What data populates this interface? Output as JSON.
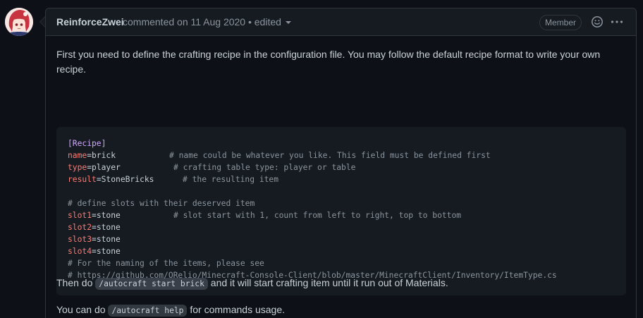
{
  "comment": {
    "author": "ReinforceZwei",
    "meta_text": "commented on 11 Aug 2020 • edited",
    "badge": "Member",
    "avatar_icon": "anime-girl-avatar",
    "emoji_icon": "smiley-icon",
    "more_icon": "kebab-horizontal-icon"
  },
  "body": {
    "intro": "First you need to define the crafting recipe in the configuration file. You may follow the default recipe format to write your own recipe.",
    "code": {
      "section": "[Recipe]",
      "name_key": "name",
      "name_val": "=brick",
      "name_comment": "# name could be whatever you like. This field must be defined first",
      "type_key": "type",
      "type_val": "=player",
      "type_comment": "# crafting table type: player or table",
      "result_key": "result",
      "result_val": "=StoneBricks",
      "result_comment": "# the resulting item",
      "slots_comment": "# define slots with their deserved item",
      "slot1_key": "slot1",
      "slot1_val": "=stone",
      "slot1_comment": "# slot start with 1, count from left to right, top to bottom",
      "slot2_key": "slot2",
      "slot2_val": "=stone",
      "slot3_key": "slot3",
      "slot3_val": "=stone",
      "slot4_key": "slot4",
      "slot4_val": "=stone",
      "naming_comment": "# For the naming of the items, please see",
      "url_comment": "# https://github.com/ORelio/Minecraft-Console-Client/blob/master/MinecraftClient/Inventory/ItemType.cs"
    },
    "then_prefix": "Then do",
    "then_code": "/autocraft start brick",
    "then_suffix": "and it will start crafting item until it run out of Materials.",
    "help_prefix": "You can do",
    "help_code": "/autocraft help",
    "help_suffix": "for commands usage."
  },
  "colors": {
    "background": "#0d1117",
    "header_bg": "#161b22",
    "border": "#30363d",
    "text": "#c9d1d9",
    "muted": "#8b949e",
    "code_section": "#d2a8ff",
    "code_key": "#ff7b72"
  }
}
